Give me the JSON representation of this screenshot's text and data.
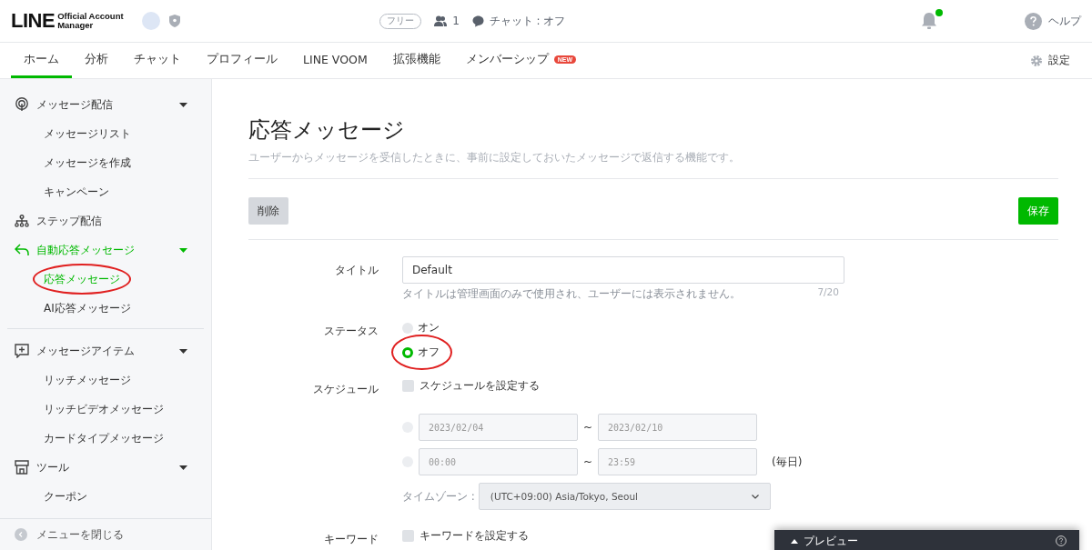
{
  "header": {
    "logo": {
      "wordmark": "LINE",
      "line1": "Official Account",
      "line2": "Manager"
    },
    "plan": "フリー",
    "friends": "1",
    "chat_status": "チャット : オフ",
    "notification_dot": true,
    "help": "ヘルプ"
  },
  "tabs": [
    {
      "label": "ホーム",
      "selected": true
    },
    {
      "label": "分析",
      "selected": false
    },
    {
      "label": "チャット",
      "selected": false
    },
    {
      "label": "プロフィール",
      "selected": false
    },
    {
      "label": "LINE VOOM",
      "selected": false
    },
    {
      "label": "拡張機能",
      "selected": false
    },
    {
      "label": "メンバーシップ",
      "selected": false,
      "badge": "NEW"
    }
  ],
  "settings": "設定",
  "sidebar": {
    "sections": [
      [
        {
          "label": "メッセージ配信",
          "kind": "broadcast",
          "selected": false,
          "expandable": true,
          "children": [
            {
              "label": "メッセージリスト",
              "selected": false,
              "circled": false
            },
            {
              "label": "メッセージを作成",
              "selected": false,
              "circled": false
            },
            {
              "label": "キャンペーン",
              "selected": false,
              "circled": false
            }
          ]
        },
        {
          "label": "ステップ配信",
          "kind": "step",
          "selected": false,
          "expandable": false
        },
        {
          "label": "自動応答メッセージ",
          "kind": "reply",
          "selected": true,
          "expandable": true,
          "children": [
            {
              "label": "応答メッセージ",
              "selected": true,
              "circled": true
            },
            {
              "label": "AI応答メッセージ",
              "selected": false,
              "circled": false
            }
          ]
        }
      ],
      [
        {
          "label": "メッセージアイテム",
          "kind": "item",
          "selected": false,
          "expandable": true,
          "children": [
            {
              "label": "リッチメッセージ",
              "selected": false,
              "circled": false
            },
            {
              "label": "リッチビデオメッセージ",
              "selected": false,
              "circled": false
            },
            {
              "label": "カードタイプメッセージ",
              "selected": false,
              "circled": false
            }
          ]
        },
        {
          "label": "ツール",
          "kind": "tool",
          "selected": false,
          "expandable": true,
          "children": [
            {
              "label": "クーポン",
              "selected": false,
              "circled": false
            }
          ]
        }
      ]
    ],
    "close_menu": "メニューを閉じる"
  },
  "page": {
    "title": "応答メッセージ",
    "description": "ユーザーからメッセージを受信したときに、事前に設定しておいたメッセージで返信する機能です。",
    "delete": "削除",
    "save": "保存"
  },
  "form": {
    "title": {
      "label": "タイトル",
      "value": "Default",
      "hint": "タイトルは管理画面のみで使用され、ユーザーには表示されません。",
      "counter": "7/20"
    },
    "status": {
      "label": "ステータス",
      "options": [
        {
          "label": "オン",
          "selected": false,
          "circled": false
        },
        {
          "label": "オフ",
          "selected": true,
          "circled": true
        }
      ]
    },
    "schedule": {
      "label": "スケジュール",
      "checkbox": {
        "label": "スケジュールを設定する",
        "checked": false
      },
      "date_from": "2023/02/04",
      "date_to": "2023/02/10",
      "time_from": "00:00",
      "time_to": "23:59",
      "separators": [
        "~",
        "~"
      ],
      "daily": "(毎日)",
      "timezone_label": "タイムゾーン :",
      "timezone": "(UTC+09:00) Asia/Tokyo, Seoul"
    },
    "keyword": {
      "label": "キーワード",
      "checkbox": {
        "label": "キーワードを設定する",
        "checked": false
      }
    }
  },
  "preview": {
    "label": "プレビュー"
  }
}
